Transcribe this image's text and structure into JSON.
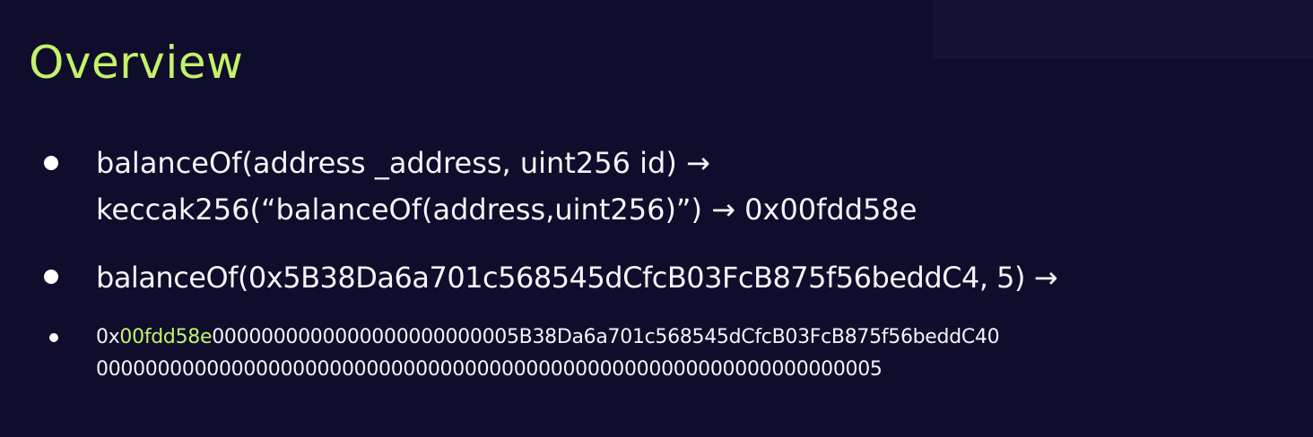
{
  "slide": {
    "title": "Overview",
    "colors": {
      "background": "#0f0d2b",
      "accent": "#c4f16a",
      "text": "#f4f4f8"
    },
    "bullet1": {
      "line1": "balanceOf(address _address, uint256 id) →",
      "line2": "keccak256(“balanceOf(address,uint256)”) → 0x00fdd58e"
    },
    "bullet2": {
      "line1": "balanceOf(0x5B38Da6a701c568545dCfcB03FcB875f56beddC4, 5) →"
    },
    "bullet3": {
      "prefix": "0x",
      "selector": "00fdd58e",
      "rest_line1": "0000000000000000000000005B38Da6a701c568545dCfcB03FcB875f56beddC40",
      "line2": "0000000000000000000000000000000000000000000000000000000000000005"
    }
  }
}
